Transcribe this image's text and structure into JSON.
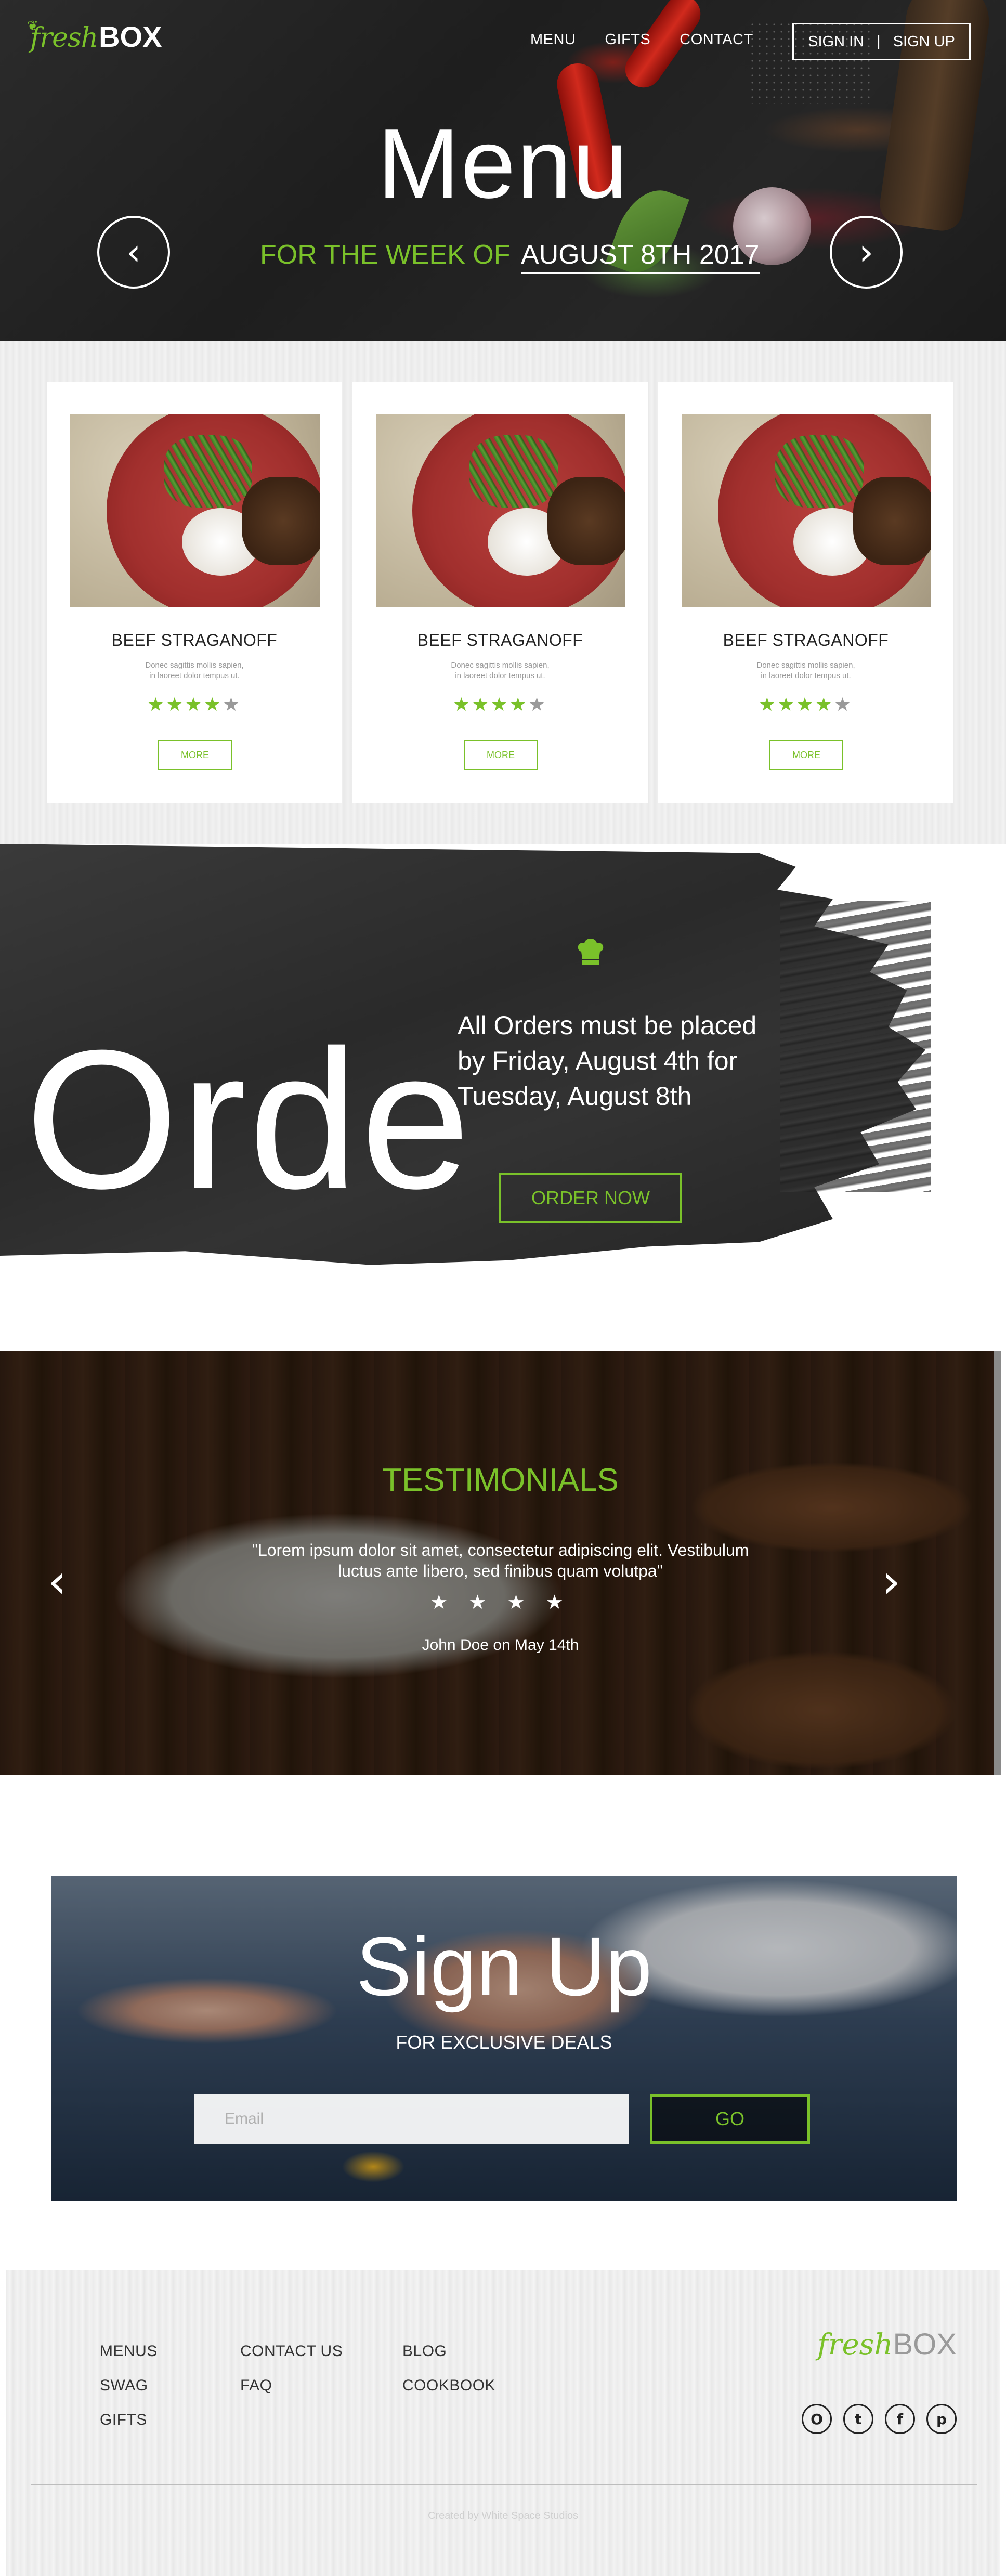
{
  "header": {
    "logo": {
      "fresh": "fresh",
      "box": "BOX"
    },
    "nav": [
      "MENU",
      "GIFTS",
      "CONTACT"
    ],
    "sign_in": "SIGN IN",
    "separator": "|",
    "sign_up": "SIGN UP"
  },
  "hero": {
    "title": "Menu",
    "week_prefix": "FOR THE WEEK OF",
    "week_date": "AUGUST 8TH 2017",
    "prev_icon": "chevron-left-icon",
    "next_icon": "chevron-right-icon"
  },
  "menu": {
    "items": [
      {
        "name": "BEEF STRAGANOFF",
        "desc_line1": "Donec sagittis mollis sapien,",
        "desc_line2": "in laoreet dolor tempus ut.",
        "rating": 4,
        "max_rating": 5,
        "button": "MORE"
      },
      {
        "name": "BEEF STRAGANOFF",
        "desc_line1": "Donec sagittis mollis sapien,",
        "desc_line2": "in laoreet dolor tempus ut.",
        "rating": 4,
        "max_rating": 5,
        "button": "MORE"
      },
      {
        "name": "BEEF STRAGANOFF",
        "desc_line1": "Donec sagittis mollis sapien,",
        "desc_line2": "in laoreet dolor tempus ut.",
        "rating": 4,
        "max_rating": 5,
        "button": "MORE"
      }
    ]
  },
  "order": {
    "big_text": "Orde",
    "icon": "chef-hat-icon",
    "line1": "All Orders must be placed",
    "line2": "by Friday, August 4th for",
    "line3": "Tuesday, August 8th",
    "button": "ORDER NOW"
  },
  "testimonials": {
    "title": "TESTIMONIALS",
    "quote_line1": "\"Lorem ipsum dolor sit amet, consectetur adipiscing elit. Vestibulum",
    "quote_line2": "luctus ante libero, sed finibus quam volutpa\"",
    "stars": "★ ★ ★ ★",
    "rating": 4,
    "author": "John Doe on May 14th"
  },
  "signup": {
    "title": "Sign Up",
    "subtitle": "FOR EXCLUSIVE DEALS",
    "email_placeholder": "Email",
    "button": "GO"
  },
  "footer": {
    "col1": [
      "MENUS",
      "SWAG",
      "GIFTS"
    ],
    "col2": [
      "CONTACT US",
      "FAQ"
    ],
    "col3": [
      "BLOG",
      "COOKBOOK"
    ],
    "logo": {
      "fresh": "fresh",
      "box": "BOX"
    },
    "social": [
      "O",
      "t",
      "f",
      "p"
    ],
    "social_icons": [
      "instagram-icon",
      "twitter-icon",
      "facebook-icon",
      "pinterest-icon"
    ],
    "credit": "Created by White Space Studios"
  },
  "colors": {
    "accent": "#7ac12a",
    "text_dark": "#222222",
    "muted": "#9a9a9a"
  }
}
